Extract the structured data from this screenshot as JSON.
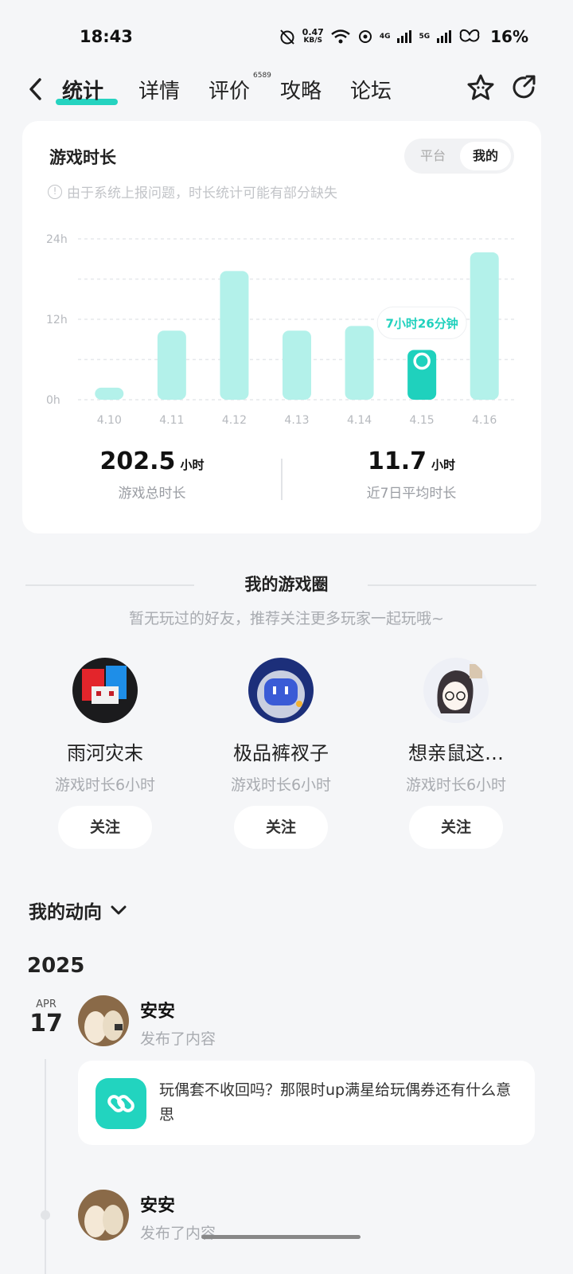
{
  "status_bar": {
    "time": "18:43",
    "net_speed_value": "0.47",
    "net_speed_unit": "KB/S",
    "sim1": "4G",
    "sim2": "5G",
    "battery": "16%"
  },
  "nav": {
    "tabs": [
      {
        "label": "统计",
        "active": true
      },
      {
        "label": "详情",
        "active": false
      },
      {
        "label": "评价",
        "active": false
      },
      {
        "label": "攻略",
        "active": false
      },
      {
        "label": "论坛",
        "active": false
      }
    ],
    "review_badge": "6589",
    "accent_color": "#25d3c0"
  },
  "playtime_card": {
    "title": "游戏时长",
    "toggle": {
      "option1": "平台",
      "option2": "我的",
      "selected": "我的"
    },
    "notice": "由于系统上报问题，时长统计可能有部分缺失",
    "stats": [
      {
        "value": "202.5",
        "unit": "小时",
        "label": "游戏总时长"
      },
      {
        "value": "11.7",
        "unit": "小时",
        "label": "近7日平均时长"
      }
    ]
  },
  "chart_data": {
    "type": "bar",
    "categories": [
      "4.10",
      "4.11",
      "4.12",
      "4.13",
      "4.14",
      "4.15",
      "4.16"
    ],
    "values": [
      1.8,
      10.3,
      19.2,
      10.3,
      11.0,
      7.43,
      22.0
    ],
    "y_ticks": [
      "0h",
      "12h",
      "24h"
    ],
    "ylim": [
      0,
      24
    ],
    "selected_index": 5,
    "tooltip": "7小时26分钟",
    "bar_color": "#b3f1ea",
    "selected_color": "#1fd1bd",
    "grid": true
  },
  "game_circle": {
    "title": "我的游戏圈",
    "subtitle": "暂无玩过的好友，推荐关注更多玩家一起玩哦~",
    "friends": [
      {
        "name": "雨河灾末",
        "hours": "游戏时长6小时",
        "follow": "关注"
      },
      {
        "name": "极品裤衩子",
        "hours": "游戏时长6小时",
        "follow": "关注"
      },
      {
        "name": "想亲鼠这…",
        "hours": "游戏时长6小时",
        "follow": "关注"
      }
    ]
  },
  "activity": {
    "header": "我的动向",
    "year": "2025",
    "date_month": "APR",
    "date_day": "17",
    "posts": [
      {
        "user": "安安",
        "action": "发布了内容",
        "content": "玩偶套不收回吗？那限时up满星给玩偶券还有什么意思"
      },
      {
        "user": "安安",
        "action": "发布了内容"
      }
    ]
  }
}
